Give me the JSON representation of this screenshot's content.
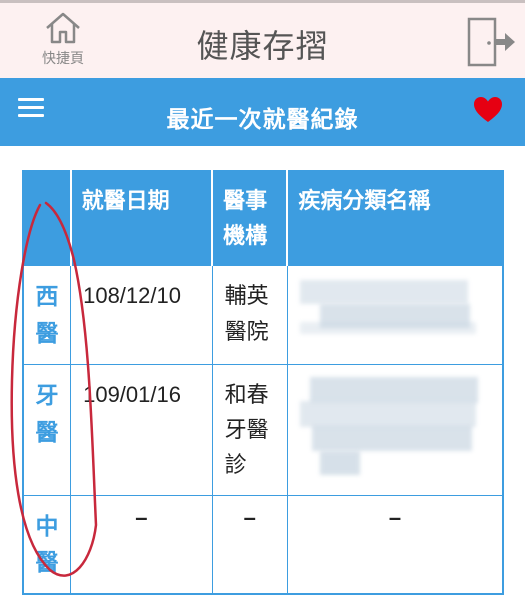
{
  "header": {
    "title": "健康存摺",
    "home_label": "快捷頁",
    "home_icon": "house-icon",
    "exit_icon": "logout-door-icon"
  },
  "navbar": {
    "title": "最近一次就醫紀錄",
    "menu_icon": "hamburger-menu-icon",
    "favorite_icon": "heart-icon",
    "favorite_color": "#e60012"
  },
  "table": {
    "columns": [
      "",
      "就醫日期",
      "醫事機構",
      "疾病分類名稱"
    ],
    "rows": [
      {
        "type": "西醫",
        "date": "108/12/10",
        "institution": "輔英醫院",
        "disease": ""
      },
      {
        "type": "牙醫",
        "date": "109/01/16",
        "institution": "和春牙醫診",
        "disease": ""
      },
      {
        "type": "中醫",
        "date": "–",
        "institution": "–",
        "disease": "–"
      }
    ]
  },
  "colors": {
    "accent": "#3d9de0",
    "header_bg": "#fdf1f1",
    "annotation": "#c8283c"
  }
}
